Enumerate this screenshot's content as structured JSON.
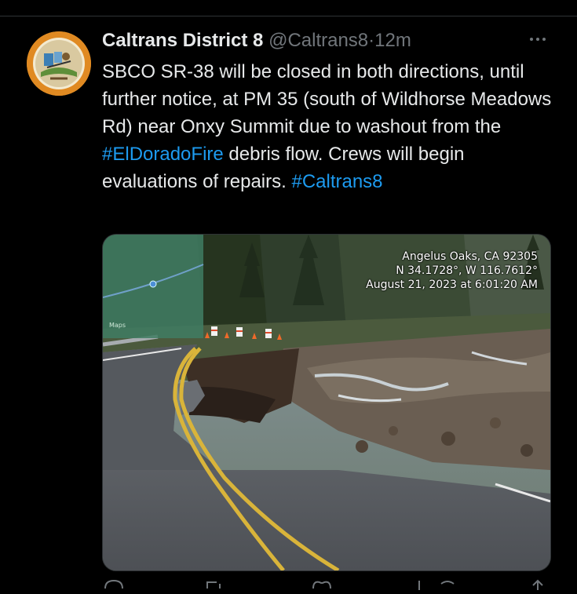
{
  "tweet": {
    "display_name": "Caltrans District 8",
    "handle": "@Caltrans8",
    "separator": "·",
    "time": "12m",
    "more_icon": "more-horizontal-icon",
    "text_parts": {
      "body": "SBCO SR-38 will be closed in both directions, until further notice, at PM 35 (south of Wildhorse Meadows Rd) near Onxy Summit due to washout from the ",
      "hashtag1": "#ElDoradoFire",
      "body2": " debris flow. Crews will begin evaluations of repairs. ",
      "hashtag2": "#Caltrans8"
    },
    "colors": {
      "background": "#000000",
      "link": "#1d9bf0",
      "muted": "#71767b",
      "text": "#e7e9ea"
    }
  },
  "photo": {
    "caption_line1": "Angelus Oaks, CA 92305",
    "caption_line2": "N 34.1728°, W 116.7612°",
    "caption_line3": "August 21, 2023 at 6:01:20 AM",
    "maps_label": "Maps"
  },
  "actions": {
    "icons": [
      "reply-icon",
      "retweet-icon",
      "like-icon",
      "views-icon",
      "share-icon"
    ]
  }
}
